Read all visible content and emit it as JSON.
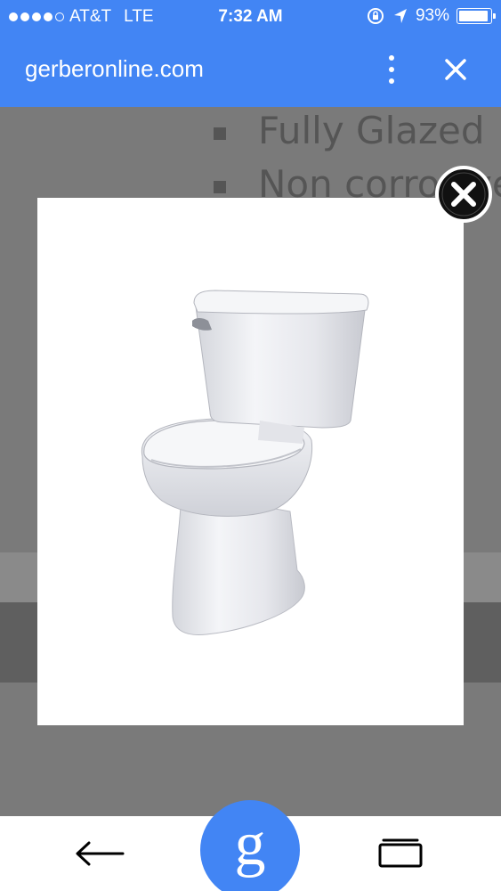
{
  "status_bar": {
    "carrier": "AT&T",
    "network": "LTE",
    "time": "7:32 AM",
    "battery": "93%",
    "battery_level": 0.93,
    "signal_dots": 5,
    "signal_filled": 4,
    "icons": [
      "rotation-lock-icon",
      "location-arrow-icon",
      "battery-icon"
    ]
  },
  "browser": {
    "url": "gerberonline.com",
    "icons": [
      "more-vertical-icon",
      "close-icon"
    ]
  },
  "background_page": {
    "bullets": [
      "Fully Glazed",
      "Non corrosive"
    ]
  },
  "lightbox": {
    "image": "toilet-product-image",
    "icons": [
      "close-circle-icon"
    ]
  },
  "bottom_nav": {
    "icons": [
      "back-arrow-icon",
      "google-search-icon",
      "tabs-icon"
    ],
    "google_label": "g"
  },
  "colors": {
    "accent": "#4285f4",
    "overlay": "#7a7a7a",
    "text_dim": "#555555"
  }
}
